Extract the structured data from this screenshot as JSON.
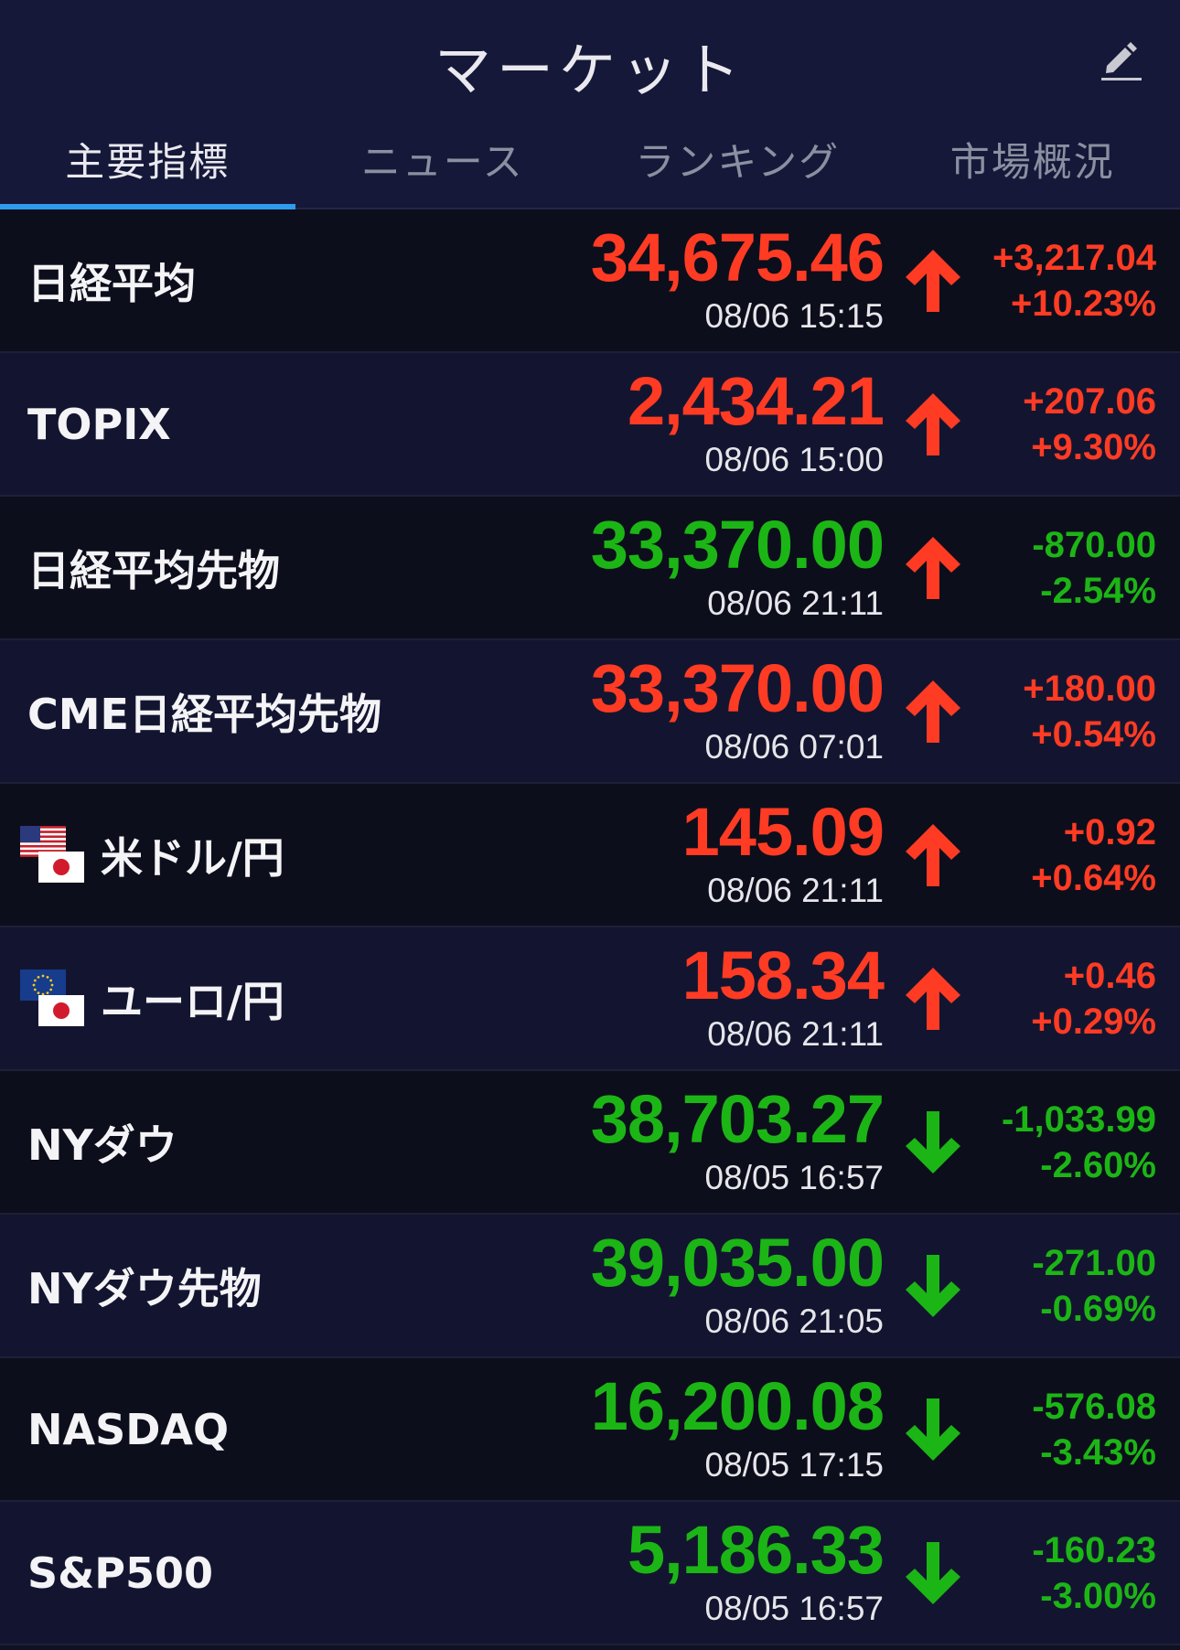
{
  "header": {
    "title": "マーケット",
    "edit_icon": "pencil-icon"
  },
  "tabs": [
    {
      "label": "主要指標",
      "active": true
    },
    {
      "label": "ニュース",
      "active": false
    },
    {
      "label": "ランキング",
      "active": false
    },
    {
      "label": "市場概況",
      "active": false
    }
  ],
  "colors": {
    "up": "#ff3b24",
    "down": "#1cb516",
    "accent": "#2f9bef"
  },
  "rows": [
    {
      "name": "日経平均",
      "price": "34,675.46",
      "time": "08/06 15:15",
      "change": "+3,217.04",
      "pct": "+10.23%",
      "price_dir": "up",
      "change_dir": "up",
      "arrow": "up"
    },
    {
      "name": "TOPIX",
      "price": "2,434.21",
      "time": "08/06 15:00",
      "change": "+207.06",
      "pct": "+9.30%",
      "price_dir": "up",
      "change_dir": "up",
      "arrow": "up"
    },
    {
      "name": "日経平均先物",
      "price": "33,370.00",
      "time": "08/06 21:11",
      "change": "-870.00",
      "pct": "-2.54%",
      "price_dir": "down",
      "change_dir": "down",
      "arrow": "up"
    },
    {
      "name": "CME日経平均先物",
      "price": "33,370.00",
      "time": "08/06 07:01",
      "change": "+180.00",
      "pct": "+0.54%",
      "price_dir": "up",
      "change_dir": "up",
      "arrow": "up"
    },
    {
      "name": "米ドル/円",
      "price": "145.09",
      "time": "08/06 21:11",
      "change": "+0.92",
      "pct": "+0.64%",
      "price_dir": "up",
      "change_dir": "up",
      "arrow": "up",
      "flags": [
        "us",
        "jp"
      ]
    },
    {
      "name": "ユーロ/円",
      "price": "158.34",
      "time": "08/06 21:11",
      "change": "+0.46",
      "pct": "+0.29%",
      "price_dir": "up",
      "change_dir": "up",
      "arrow": "up",
      "flags": [
        "eu",
        "jp"
      ]
    },
    {
      "name": "NYダウ",
      "price": "38,703.27",
      "time": "08/05 16:57",
      "change": "-1,033.99",
      "pct": "-2.60%",
      "price_dir": "down",
      "change_dir": "down",
      "arrow": "down"
    },
    {
      "name": "NYダウ先物",
      "price": "39,035.00",
      "time": "08/06 21:05",
      "change": "-271.00",
      "pct": "-0.69%",
      "price_dir": "down",
      "change_dir": "down",
      "arrow": "down"
    },
    {
      "name": "NASDAQ",
      "price": "16,200.08",
      "time": "08/05 17:15",
      "change": "-576.08",
      "pct": "-3.43%",
      "price_dir": "down",
      "change_dir": "down",
      "arrow": "down"
    },
    {
      "name": "S&P500",
      "price": "5,186.33",
      "time": "08/05 16:57",
      "change": "-160.23",
      "pct": "-3.00%",
      "price_dir": "down",
      "change_dir": "down",
      "arrow": "down"
    }
  ]
}
